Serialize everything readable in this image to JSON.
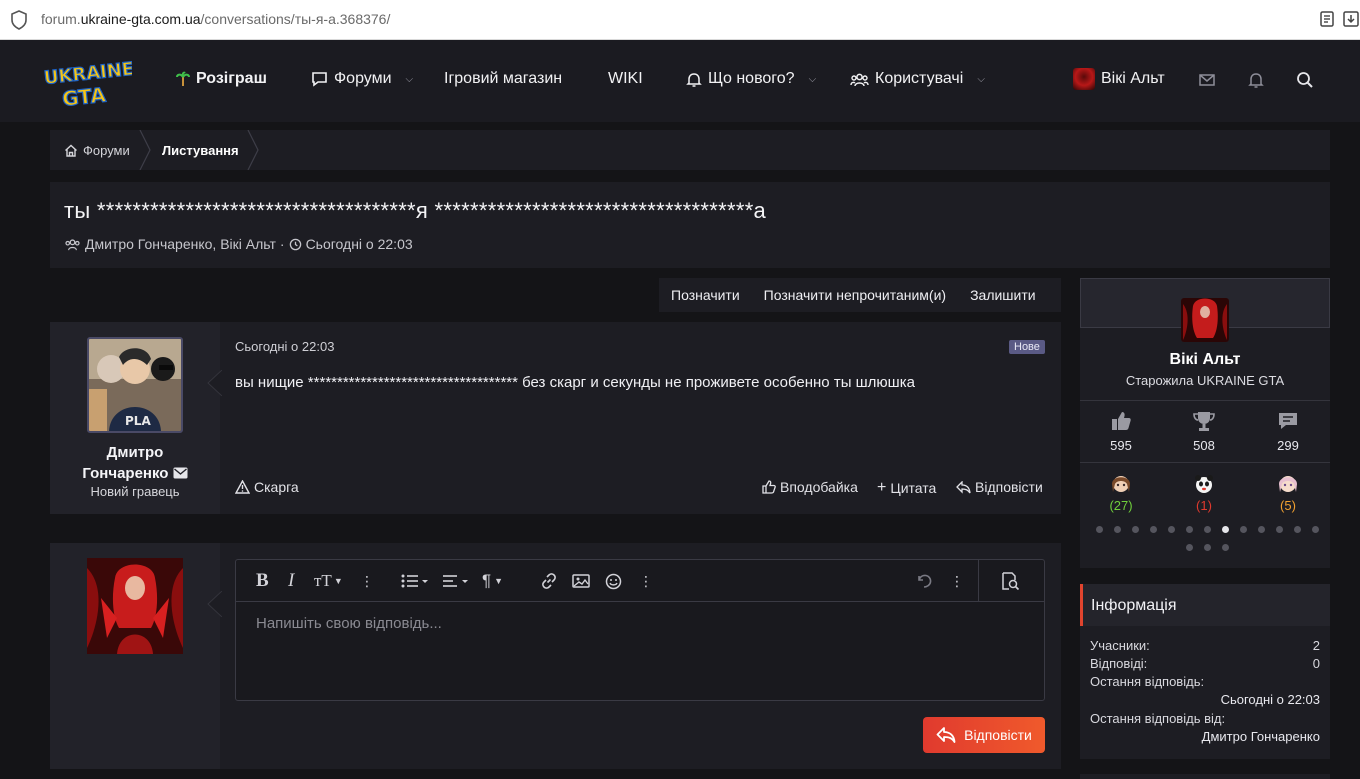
{
  "browser": {
    "url_prefix": "forum.",
    "url_host": "ukraine-gta.com.ua",
    "url_path": "/conversations/ты-я-а.368376/"
  },
  "nav": {
    "logo_line1": "UKRAINE",
    "logo_line2": "GTA",
    "items": [
      {
        "label": "Розіграш"
      },
      {
        "label": "Форуми"
      },
      {
        "label": "Ігровий магазин"
      },
      {
        "label": "WIKI"
      },
      {
        "label": "Що нового?"
      },
      {
        "label": "Користувачі"
      }
    ],
    "user": "Вікі Альт"
  },
  "breadcrumb": {
    "home": "Форуми",
    "current": "Листування"
  },
  "conversation": {
    "title": "ты ************************************я ************************************а",
    "participants": "Дмитро Гончаренко, Вікі Альт",
    "separator": "·",
    "date": "Сьогодні о 22:03"
  },
  "actions": {
    "mark": "Позначити",
    "mark_unread": "Позначити непрочитаним(и)",
    "leave": "Залишити"
  },
  "message": {
    "author_line1": "Дмитро",
    "author_line2": "Гончаренко",
    "author_title": "Новий гравець",
    "date": "Сьогодні о 22:03",
    "badge": "Нове",
    "body": "вы нищие ************************************ без скарг и секунды не проживете особенно ты шлюшка",
    "report": "Скарга",
    "like": "Вподобайка",
    "quote": "Цитата",
    "reply": "Відповісти"
  },
  "reply": {
    "placeholder": "Напишіть свою відповідь...",
    "button": "Відповісти"
  },
  "profile": {
    "name": "Вікі Альт",
    "title": "Старожила UKRAINE GTA",
    "stats": [
      "595",
      "508",
      "299"
    ],
    "reactions": [
      {
        "count": "(27)",
        "color": "#6fcf3c"
      },
      {
        "count": "(1)",
        "color": "#e03a2e"
      },
      {
        "count": "(5)",
        "color": "#f0a030"
      }
    ],
    "dots_total": 16,
    "dots_active": 7
  },
  "info": {
    "heading": "Інформація",
    "participants_label": "Учасники:",
    "participants_value": "2",
    "replies_label": "Відповіді:",
    "replies_value": "0",
    "last_reply_label": "Остання відповідь:",
    "last_reply_value": "Сьогодні о 22:03",
    "last_reply_by_label": "Остання відповідь від:",
    "last_reply_by_value": "Дмитро Гончаренко"
  },
  "colors": {
    "accent": "#e03a2e",
    "background": "#141417",
    "panel": "#1d1d23"
  }
}
